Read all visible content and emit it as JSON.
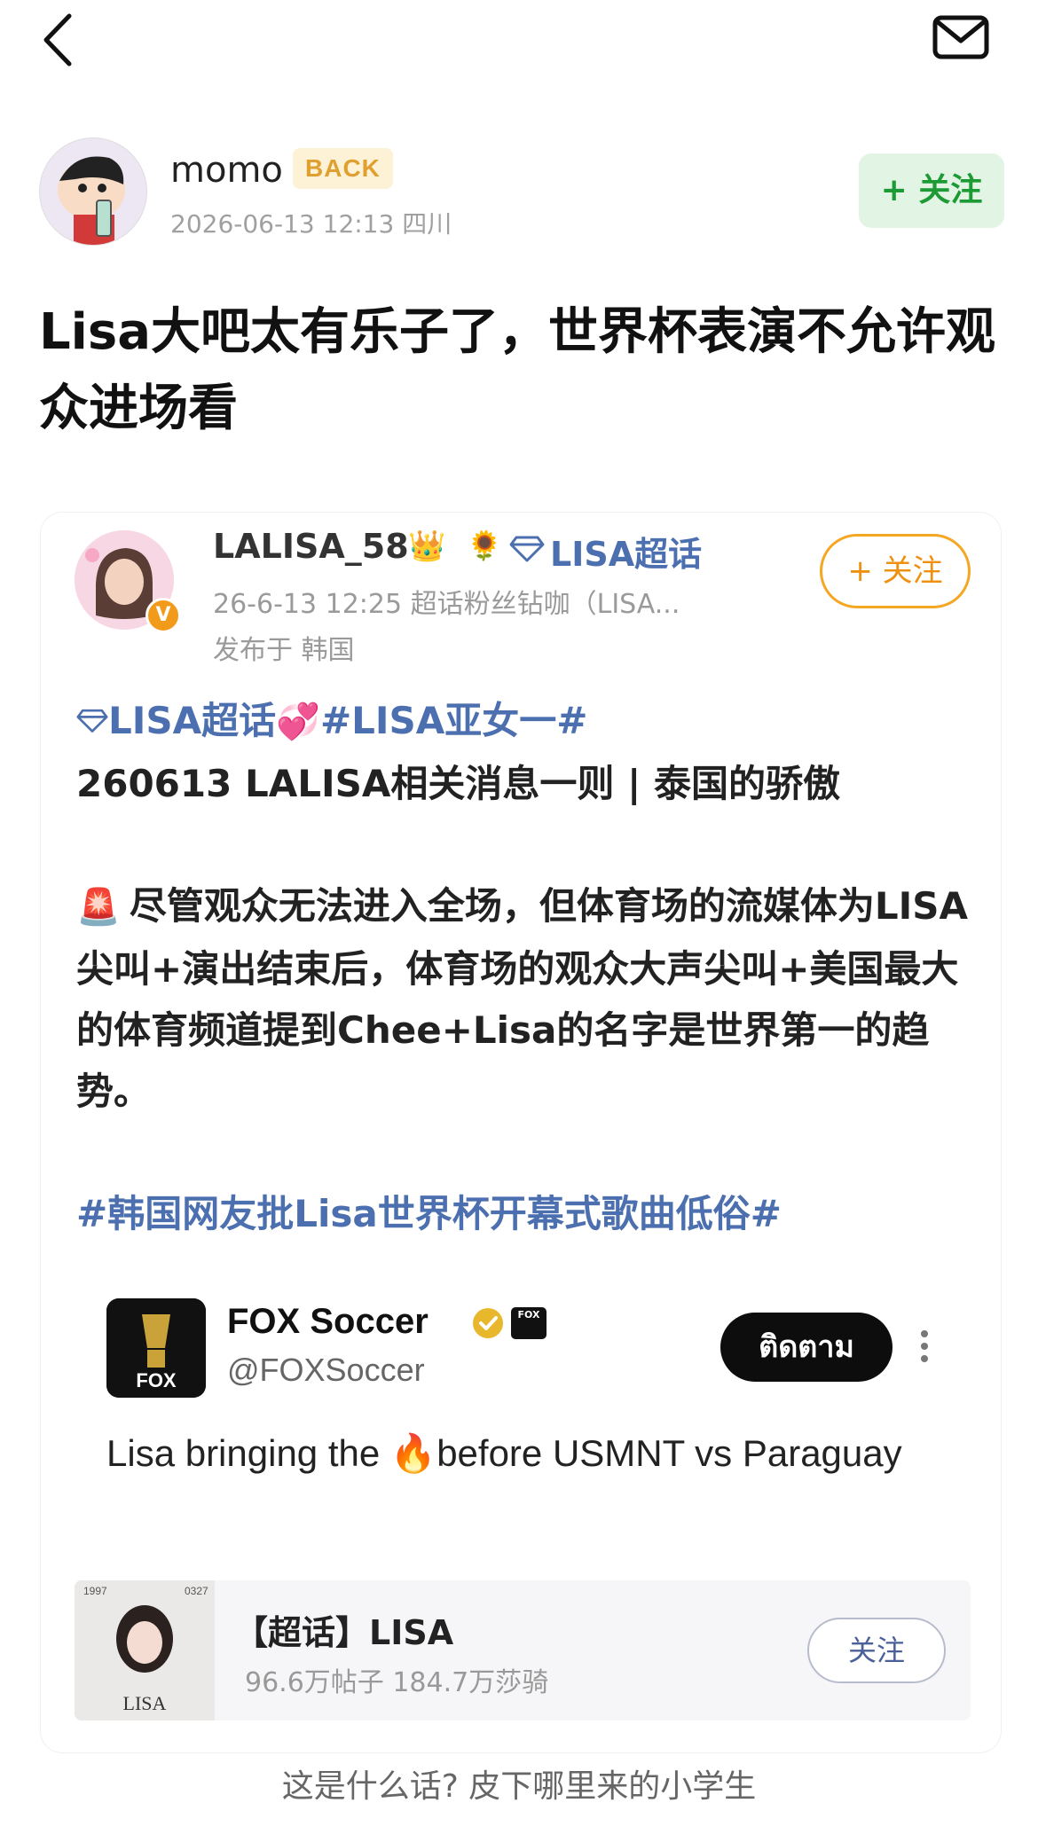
{
  "header": {
    "back_icon": "chevron-left-icon",
    "mail_icon": "mail-icon"
  },
  "author": {
    "name": "momo",
    "badge": "BACK",
    "meta": "2026-06-13 12:13  四川",
    "follow_label": "+ 关注"
  },
  "post": {
    "title": "Lisa大吧太有乐子了，世界杯表演不允许观众进场看"
  },
  "weibo": {
    "name": "LALISA_58",
    "supertopic": "LISA超话",
    "meta": "26-6-13 12:25   超话粉丝钻咖（LISA...",
    "location": "发布于 韩国",
    "follow_label": "+ 关注",
    "verified_badge": "V",
    "body": {
      "tag1": "LISA超话",
      "tag2": "#LISA亚女一#",
      "line1": "260613 LALISA相关消息一则 | 泰国的骄傲",
      "para2": "尽管观众无法进入全场，但体育场的流媒体为LISA尖叫+演出结束后，体育场的观众大声尖叫+美国最大的体育频道提到Chee+Lisa的名字是世界第一的趋势。",
      "tag3": "#韩国网友批Lisa世界杯开幕式歌曲低俗#"
    },
    "tweet": {
      "name": "FOX Soccer",
      "handle": "@FOXSoccer",
      "follow_label": "ติดตาม",
      "logo_text": "FOX",
      "brand_text": "FOX",
      "text_part1": "Lisa bringing the ",
      "text_part2": "before USMNT vs Paraguay"
    },
    "topic": {
      "title": "【超话】LISA",
      "stats": "96.6万帖子 184.7万莎骑",
      "follow_label": "关注",
      "thumb_text": "LISA",
      "thumb_left": "1997",
      "thumb_right": "0327"
    }
  },
  "comment": {
    "text": "这是什么话? 皮下哪里来的小学生"
  },
  "colors": {
    "accent_green": "#1c9a34",
    "link_blue": "#4c6fb0",
    "accent_orange": "#f09010"
  }
}
